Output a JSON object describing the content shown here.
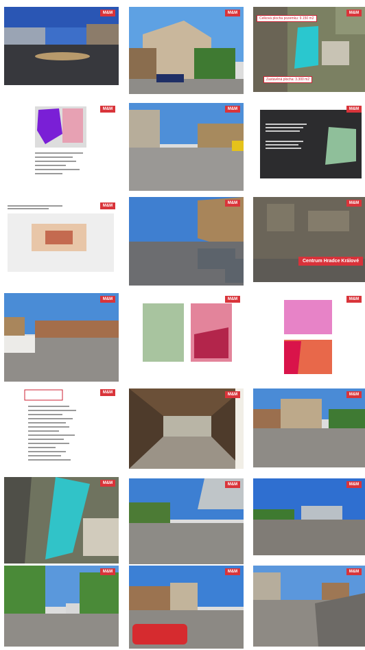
{
  "gallery": {
    "logo_text": "M&M",
    "labels": {
      "total_area": "Celková plocha pozemku: 9.150 m2",
      "built_area": "Zastavěná plocha: 3.300 m2",
      "centre": "Centrum Hradce Králové"
    }
  }
}
